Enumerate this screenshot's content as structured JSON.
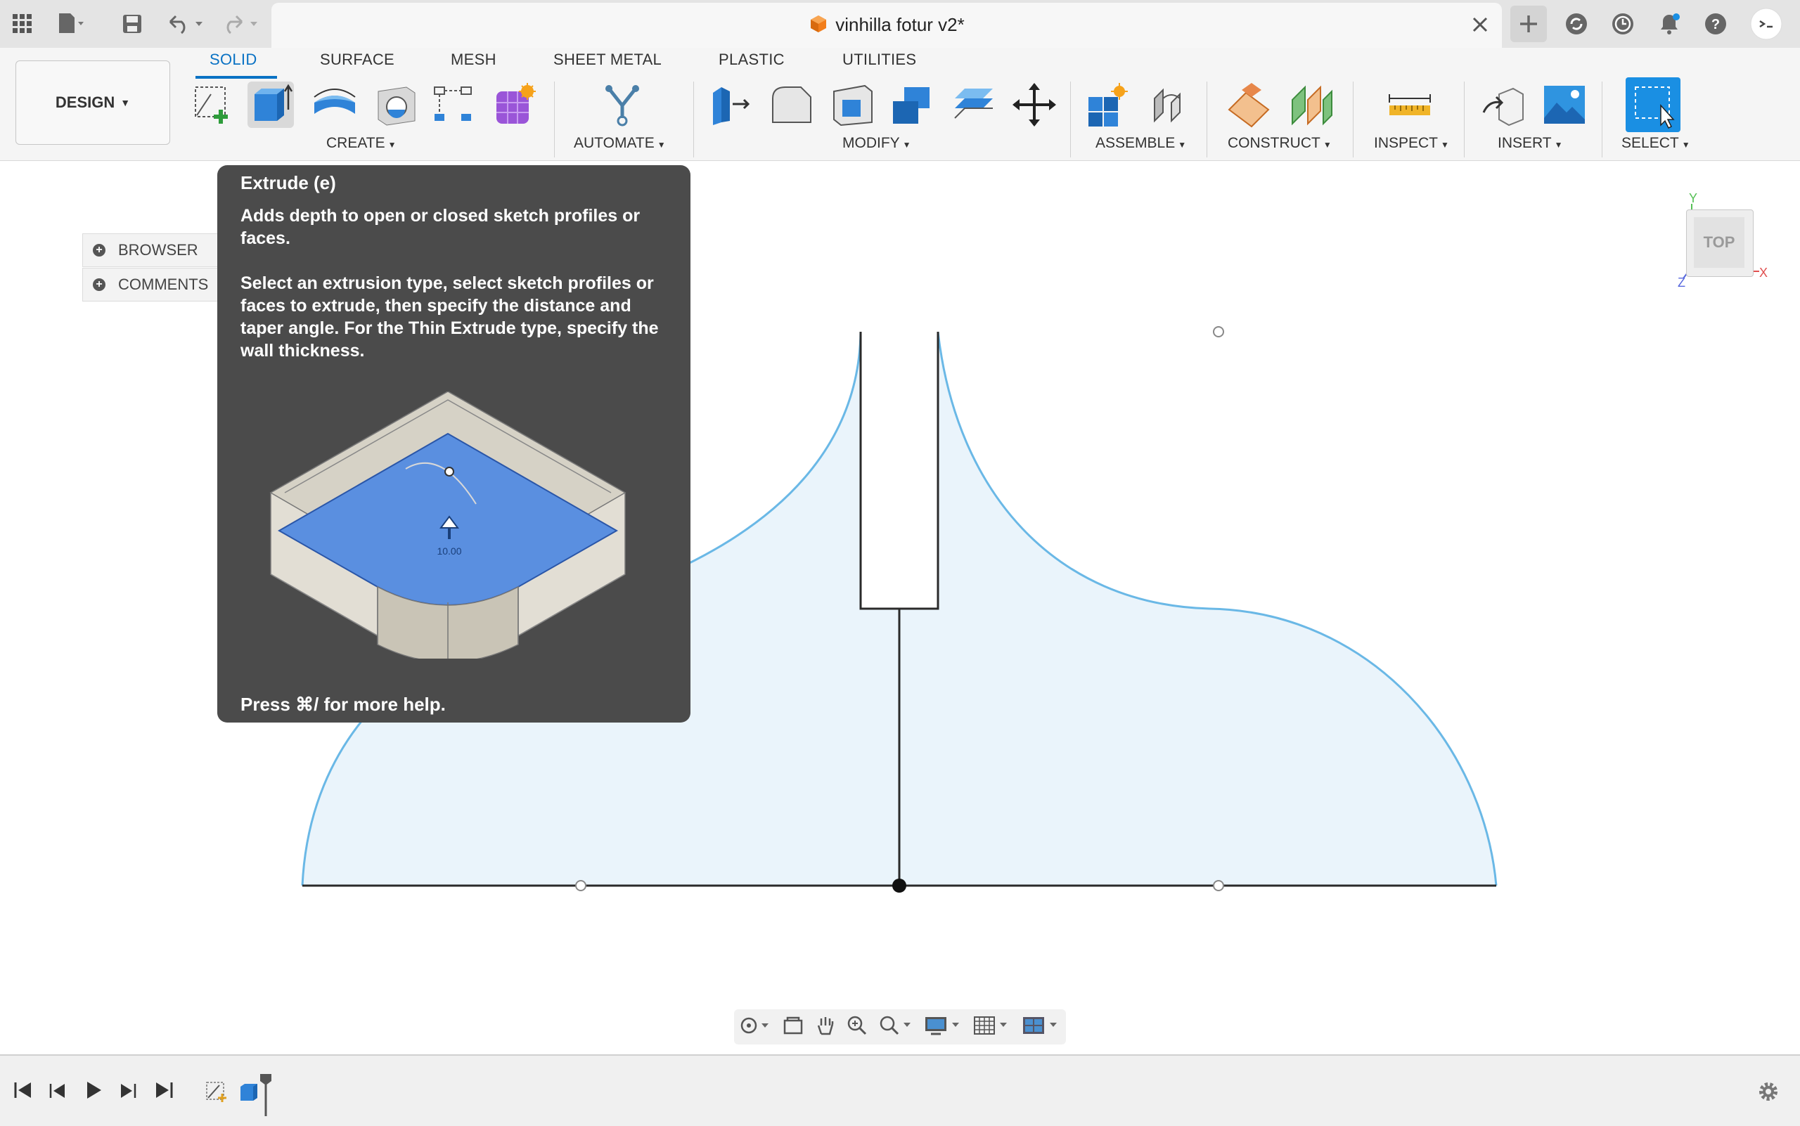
{
  "titlebar": {
    "document_title": "vinhilla fotur v2*",
    "icons": [
      "app-grid-icon",
      "file-icon",
      "save-icon",
      "undo-icon",
      "redo-icon",
      "close-tab-icon",
      "new-tab-icon",
      "sync-icon",
      "history-icon",
      "notifications-icon",
      "help-icon",
      "user-icon"
    ]
  },
  "tabs": [
    {
      "label": "SOLID",
      "active": true
    },
    {
      "label": "SURFACE"
    },
    {
      "label": "MESH"
    },
    {
      "label": "SHEET METAL"
    },
    {
      "label": "PLASTIC"
    },
    {
      "label": "UTILITIES"
    }
  ],
  "workspace": {
    "label": "DESIGN"
  },
  "groups": {
    "create": "CREATE",
    "automate": "AUTOMATE",
    "modify": "MODIFY",
    "assemble": "ASSEMBLE",
    "construct": "CONSTRUCT",
    "inspect": "INSPECT",
    "insert": "INSERT",
    "select": "SELECT"
  },
  "panel": {
    "browser": "BROWSER",
    "comments": "COMMENTS"
  },
  "tooltip": {
    "title": "Extrude (e)",
    "summary": "Adds depth to open or closed sketch profiles or faces.",
    "description": "Select an extrusion type, select sketch profiles or faces to extrude, then specify the distance and taper angle. For the Thin Extrude type, specify the wall thickness.",
    "image_value": "10.00",
    "footer": "Press ⌘/ for more help."
  },
  "viewcube": {
    "face_label": "TOP",
    "axes": {
      "y": "Y",
      "x": "X",
      "z": "Z"
    }
  },
  "colors": {
    "accent": "#0a72c4",
    "tooltip_bg": "#4b4b4b",
    "sketch_fill": "#eaf4fb",
    "sketch_curve": "#6ab8e6"
  }
}
